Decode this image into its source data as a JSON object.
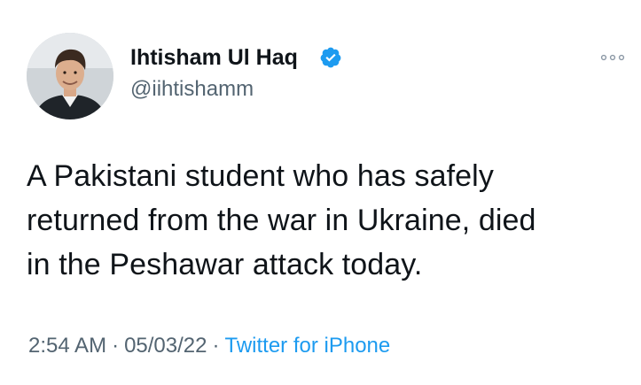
{
  "author": {
    "display_name": "Ihtisham Ul Haq",
    "handle": "@iihtishamm",
    "verified": true
  },
  "tweet": {
    "lines": [
      "A Pakistani student who has safely",
      "returned from the war in Ukraine, died",
      "in the Peshawar attack today."
    ]
  },
  "meta": {
    "time": "2:54 AM",
    "separator": "·",
    "date": "05/03/22",
    "source": "Twitter for iPhone"
  },
  "colors": {
    "accent": "#1d9bf0",
    "text": "#0f1419",
    "secondary": "#536471",
    "background": "#ffffff"
  },
  "icons": {
    "verified": "verified-badge-icon",
    "more": "more-options-icon"
  }
}
